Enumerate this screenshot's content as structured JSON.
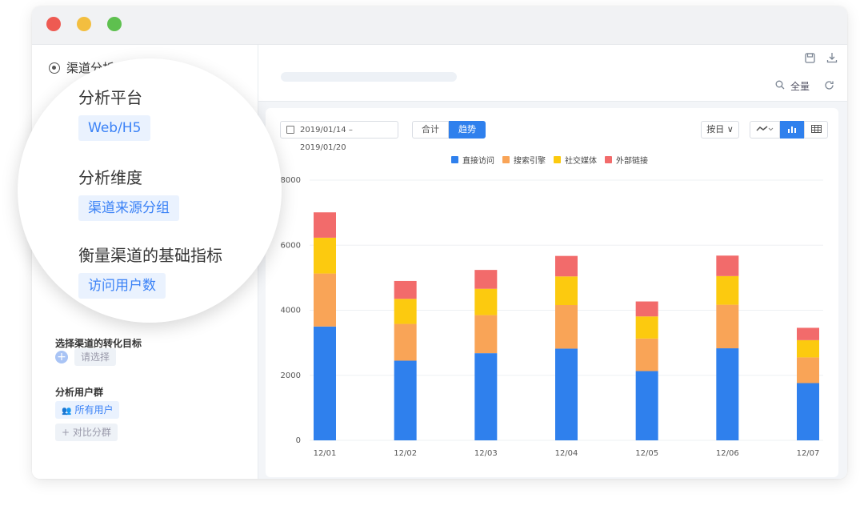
{
  "window": {
    "sidebar": {
      "title": "渠道分析",
      "conversion_label": "选择渠道的转化目标",
      "conversion_placeholder": "请选择",
      "user_group_label": "分析用户群",
      "user_group_value": "所有用户",
      "compare_label": "+ 对比分群"
    },
    "magnifier": {
      "platform_heading": "分析平台",
      "platform_value": "Web/H5",
      "dimension_heading": "分析维度",
      "dimension_value": "渠道来源分组",
      "metric_heading": "衡量渠道的基础指标",
      "metric_value": "访问用户数"
    },
    "toolbar": {
      "zoom_label": "全量"
    },
    "controls": {
      "date_range": "2019/01/14 – 2019/01/20",
      "tab_total": "合计",
      "tab_trend": "趋势",
      "granularity": "按日 ∨"
    }
  },
  "chart_data": {
    "type": "bar",
    "stacked": true,
    "categories": [
      "12/01",
      "12/02",
      "12/03",
      "12/04",
      "12/05",
      "12/06",
      "12/07"
    ],
    "series": [
      {
        "name": "直接访问",
        "color": "#2f80ed",
        "values": [
          3500,
          2450,
          2680,
          2820,
          2130,
          2830,
          1760
        ]
      },
      {
        "name": "搜索引擎",
        "color": "#f9a457",
        "values": [
          1630,
          1130,
          1170,
          1340,
          1000,
          1340,
          790
        ]
      },
      {
        "name": "社交媒体",
        "color": "#fcca0f",
        "values": [
          1100,
          770,
          810,
          880,
          680,
          880,
          530
        ]
      },
      {
        "name": "外部链接",
        "color": "#f26b6b",
        "values": [
          780,
          550,
          580,
          630,
          460,
          630,
          380
        ]
      }
    ],
    "ylim": [
      0,
      8000
    ],
    "yticks": [
      0,
      2000,
      4000,
      6000,
      8000
    ],
    "legend_position": "top-center",
    "grid": true
  }
}
